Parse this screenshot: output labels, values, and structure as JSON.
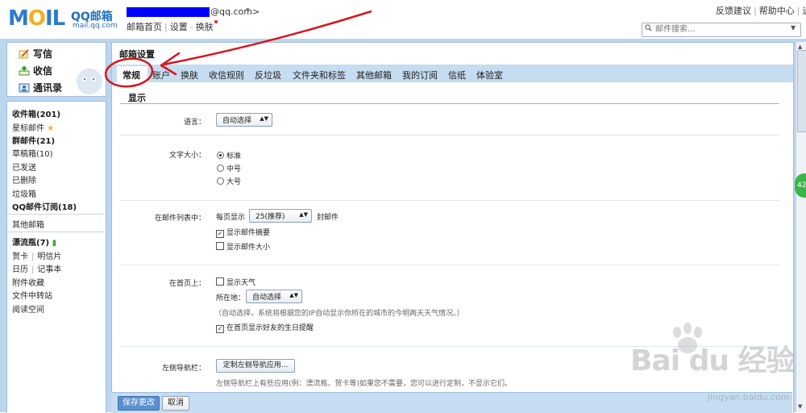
{
  "logo": {
    "brand": "MOIL",
    "qq": "QQ邮箱",
    "domain": "mail.qq.com"
  },
  "user": {
    "domain_suffix": "@qq.com>",
    "caret": "▾"
  },
  "header": {
    "home": "邮箱首页",
    "settings": "设置",
    "skin": "换肤"
  },
  "top_links": {
    "feedback": "反馈建议",
    "help": "帮助中心",
    "logout": "退出"
  },
  "search": {
    "placeholder": "邮件搜索..."
  },
  "sidebar": {
    "write": "写信",
    "receive": "收信",
    "contacts": "通讯录",
    "inbox": "收件箱(201)",
    "starred": "星标邮件",
    "group": "群邮件(21)",
    "drafts": "草稿箱(10)",
    "sent": "已发送",
    "deleted": "已删除",
    "spam": "垃圾箱",
    "qq_sub": "QQ邮件订阅(18)",
    "other": "其他邮箱",
    "bottle": "漂流瓶(7)",
    "card": "贺卡",
    "postcard": "明信片",
    "calendar": "日历",
    "notes": "记事本",
    "attachments": "附件收藏",
    "transfer": "文件中转站",
    "reading": "阅读空间"
  },
  "main": {
    "title": "邮箱设置",
    "tabs": [
      "常规",
      "账户",
      "换肤",
      "收信规则",
      "反垃圾",
      "文件夹和标签",
      "其他邮箱",
      "我的订阅",
      "信纸",
      "体验室"
    ],
    "section": "显示",
    "language": {
      "label": "语言：",
      "value": "自动选择"
    },
    "font_size": {
      "label": "文字大小：",
      "options": [
        "标准",
        "中号",
        "大号"
      ]
    },
    "list": {
      "label": "在邮件列表中：",
      "per_page": "每页显示",
      "per_page_value": "25(推荐)",
      "unit": "封邮件",
      "show_summary": "显示邮件摘要",
      "show_size": "显示邮件大小"
    },
    "home": {
      "label": "在首页上：",
      "weather": "显示天气",
      "location_label": "所在地：",
      "location_value": "自动选择",
      "note": "（自动选择，系统将根据您的IP自动显示你所在的城市的今明两天天气情况。）",
      "birthday": "在首页显示好友的生日提醒"
    },
    "left_nav": {
      "label": "左侧导航栏：",
      "button": "定制左侧导航应用...",
      "note": "左侧导航栏上有些应用(例：漂流瓶、贺卡等)如果您不需要，您可以进行定制，不显示它们。"
    }
  },
  "footer": {
    "save": "保存更改",
    "cancel": "取消"
  },
  "watermark": {
    "text": "Bai du 经验",
    "url": "jingyan.baidu.com"
  },
  "bubble": "42",
  "colors": {
    "accent_blue": "#2b7bd0",
    "band": "#bcd6ee",
    "annotation_red": "#d4161b",
    "user_redact": "#0000ff"
  }
}
